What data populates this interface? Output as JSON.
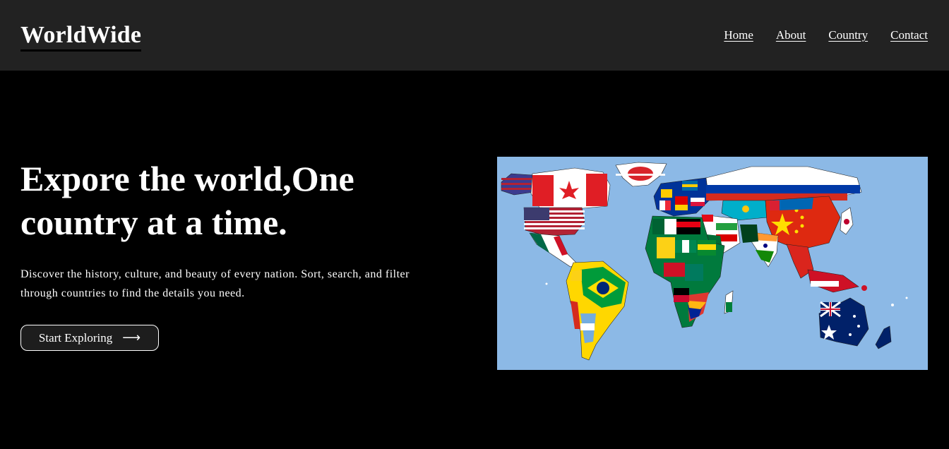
{
  "header": {
    "logo": "WorldWide",
    "nav": [
      "Home",
      "About",
      "Country",
      "Contact"
    ]
  },
  "hero": {
    "title": "Expore the world,One country at a time.",
    "description": "Discover the history, culture, and beauty of every nation. Sort, search, and filter through countries to find the details you need.",
    "cta_label": "Start Exploring",
    "cta_icon": "arrow-right-icon"
  },
  "map": {
    "image": "world map colored with national flags",
    "ocean_color": "#8cb9e6"
  },
  "colors": {
    "background": "#000000",
    "header": "#222222",
    "text": "#ffffff"
  }
}
